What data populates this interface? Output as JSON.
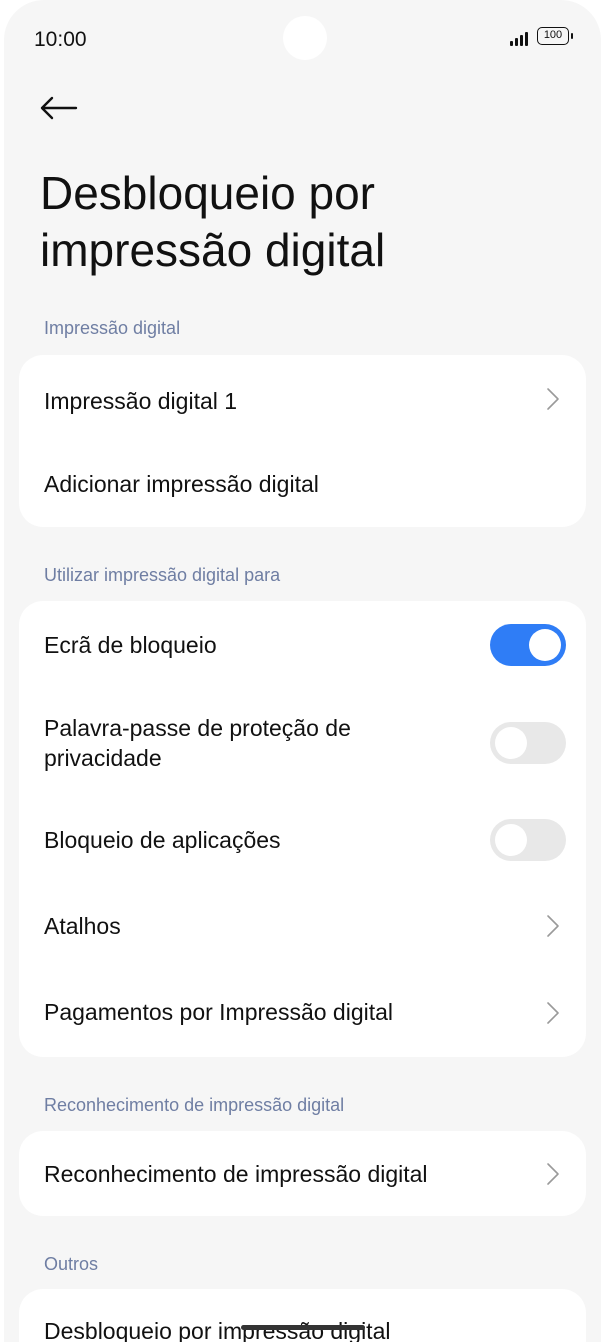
{
  "status_bar": {
    "time": "10:00",
    "battery": "100"
  },
  "header": {
    "title": "Desbloqueio por impressão digital"
  },
  "sections": {
    "fingerprints": {
      "label": "Impressão digital",
      "items": [
        "Impressão digital 1",
        "Adicionar impressão digital"
      ]
    },
    "use_for": {
      "label": "Utilizar impressão digital para",
      "items": [
        {
          "label": "Ecrã de bloqueio",
          "toggle": true
        },
        {
          "label": "Palavra-passe de proteção de privacidade",
          "toggle": false
        },
        {
          "label": "Bloqueio de aplicações",
          "toggle": false
        },
        {
          "label": "Atalhos"
        },
        {
          "label": "Pagamentos por Impressão digital"
        }
      ]
    },
    "recognition": {
      "label": "Reconhecimento de impressão digital",
      "items": [
        "Reconhecimento de impressão digital"
      ]
    },
    "others": {
      "label": "Outros",
      "items": [
        "Desbloqueio por impressão digital"
      ]
    }
  },
  "colors": {
    "accent": "#2f7df6",
    "section_label": "#6f7ea3",
    "background": "#f6f6f6"
  },
  "icons": [
    "back-arrow-icon",
    "chevron-right-icon",
    "signal-icon",
    "battery-icon"
  ]
}
